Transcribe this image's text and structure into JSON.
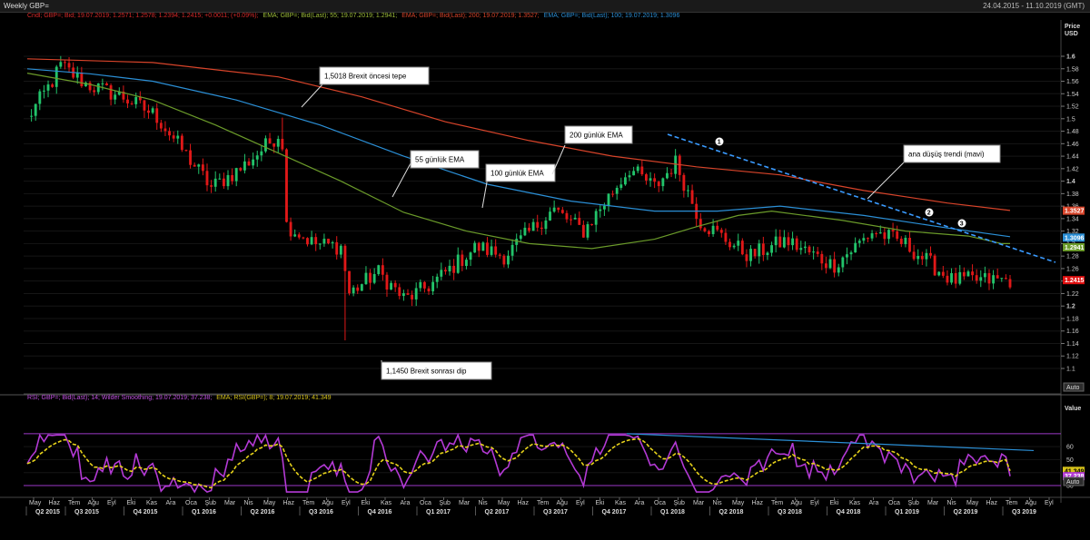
{
  "header": {
    "title": "Weekly GBP=",
    "date_range": "24.04.2015 - 11.10.2019 (GMT)"
  },
  "legend_main": {
    "candles": "Cndl; GBP=; Bid; 19.07.2019; 1.2571; 1.2578; 1.2394; 1.2415; +0.0011; (+0.09%);",
    "ema55": "EMA; GBP=; Bid(Last); 55; 19.07.2019; 1.2941;",
    "ema200": "EMA; GBP=; Bid(Last); 200; 19.07.2019; 1.3527;",
    "ema100": "EMA; GBP=; Bid(Last); 100; 19.07.2019; 1.3096"
  },
  "legend_rsi": {
    "rsi": "RSI; GBP=; Bid(Last); 14; Wilder Smoothing; 19.07.2019; 37.238;",
    "ema": "EMA; RSI(GBP=); 8; 19.07.2019; 41.349"
  },
  "axis_main": {
    "unit_line1": "Price",
    "unit_line2": "USD",
    "ticks": [
      "1.6",
      "1.58",
      "1.56",
      "1.54",
      "1.52",
      "1.5",
      "1.48",
      "1.46",
      "1.44",
      "1.42",
      "1.4",
      "1.38",
      "1.36",
      "1.34",
      "1.32",
      "1.3",
      "1.28",
      "1.26",
      "1.24",
      "1.22",
      "1.2",
      "1.18",
      "1.16",
      "1.14",
      "1.12",
      "1.1"
    ],
    "auto": "Auto"
  },
  "axis_rsi": {
    "unit": "Value",
    "ticks": [
      "60",
      "50",
      "40",
      "30"
    ],
    "auto": "Auto"
  },
  "price_tags": [
    {
      "label": "1.3527",
      "value": 1.3527,
      "color": "#d8442a"
    },
    {
      "label": "1.3096",
      "value": 1.3096,
      "color": "#2b8fd6"
    },
    {
      "label": "1.2941",
      "value": 1.2941,
      "color": "#6b9b2a"
    },
    {
      "label": "1.2415",
      "value": 1.2415,
      "color": "#e01010"
    }
  ],
  "rsi_tags": [
    {
      "label": "41.349",
      "value": 41.349,
      "color": "#d6c21a",
      "text": "#000"
    },
    {
      "label": "37.238",
      "value": 37.238,
      "color": "#b43ad6",
      "text": "#fff"
    }
  ],
  "x_months": [
    "May",
    "Haz",
    "Tem",
    "Ağu",
    "Eyl",
    "Eki",
    "Kas",
    "Ara",
    "Oca",
    "Şub",
    "Mar",
    "Nis",
    "May",
    "Haz",
    "Tem",
    "Ağu",
    "Eyl",
    "Eki",
    "Kas",
    "Ara",
    "Oca",
    "Şub",
    "Mar",
    "Nis",
    "May",
    "Haz",
    "Tem",
    "Ağu",
    "Eyl",
    "Eki",
    "Kas",
    "Ara",
    "Oca",
    "Şub",
    "Mar",
    "Nis",
    "May",
    "Haz",
    "Tem",
    "Ağu",
    "Eyl",
    "Eki",
    "Kas",
    "Ara",
    "Oca",
    "Şub",
    "Mar",
    "Nis",
    "May",
    "Haz",
    "Tem",
    "Ağu",
    "Eyl"
  ],
  "x_quarters": [
    {
      "label": "Q2 2015",
      "month": 0
    },
    {
      "label": "Q3 2015",
      "month": 2
    },
    {
      "label": "Q4 2015",
      "month": 5
    },
    {
      "label": "Q1 2016",
      "month": 8
    },
    {
      "label": "Q2 2016",
      "month": 11
    },
    {
      "label": "Q3 2016",
      "month": 14
    },
    {
      "label": "Q4 2016",
      "month": 17
    },
    {
      "label": "Q1 2017",
      "month": 20
    },
    {
      "label": "Q2 2017",
      "month": 23
    },
    {
      "label": "Q3 2017",
      "month": 26
    },
    {
      "label": "Q4 2017",
      "month": 29
    },
    {
      "label": "Q1 2018",
      "month": 32
    },
    {
      "label": "Q2 2018",
      "month": 35
    },
    {
      "label": "Q3 2018",
      "month": 38
    },
    {
      "label": "Q4 2018",
      "month": 41
    },
    {
      "label": "Q1 2019",
      "month": 44
    },
    {
      "label": "Q2 2019",
      "month": 47
    },
    {
      "label": "Q3 2019",
      "month": 50
    }
  ],
  "annotations": {
    "brexit_top": "1,5018 Brexit öncesi tepe",
    "brexit_dip": "1,1450 Brexit sonrası dip",
    "ema55": "55 günlük EMA",
    "ema100": "100 günlük EMA",
    "ema200": "200 günlük EMA",
    "trend": "ana düşüş trendi (mavi)",
    "n1": "1",
    "n2": "2",
    "n3": "3"
  },
  "chart_data": {
    "type": "line",
    "title": "Weekly GBP=",
    "ylabel": "Price USD",
    "ylim": [
      1.09,
      1.615
    ],
    "x_range": [
      "2015-04-24",
      "2019-10-11"
    ],
    "close_anchors": [
      {
        "x": "2015-04-24",
        "y": 1.5
      },
      {
        "x": "2015-06-05",
        "y": 1.56
      },
      {
        "x": "2015-06-19",
        "y": 1.585
      },
      {
        "x": "2015-08-01",
        "y": 1.555
      },
      {
        "x": "2015-10-01",
        "y": 1.535
      },
      {
        "x": "2015-11-25",
        "y": 1.505
      },
      {
        "x": "2016-01-25",
        "y": 1.43
      },
      {
        "x": "2016-02-26",
        "y": 1.39
      },
      {
        "x": "2016-04-15",
        "y": 1.42
      },
      {
        "x": "2016-05-20",
        "y": 1.45
      },
      {
        "x": "2016-06-23",
        "y": 1.48
      },
      {
        "x": "2016-07-01",
        "y": 1.33
      },
      {
        "x": "2016-08-15",
        "y": 1.3
      },
      {
        "x": "2016-09-30",
        "y": 1.295
      },
      {
        "x": "2016-10-14",
        "y": 1.22
      },
      {
        "x": "2016-12-01",
        "y": 1.255
      },
      {
        "x": "2017-01-15",
        "y": 1.21
      },
      {
        "x": "2017-03-01",
        "y": 1.235
      },
      {
        "x": "2017-05-15",
        "y": 1.295
      },
      {
        "x": "2017-07-01",
        "y": 1.28
      },
      {
        "x": "2017-09-20",
        "y": 1.355
      },
      {
        "x": "2017-11-10",
        "y": 1.32
      },
      {
        "x": "2018-01-26",
        "y": 1.42
      },
      {
        "x": "2018-03-10",
        "y": 1.39
      },
      {
        "x": "2018-04-13",
        "y": 1.43
      },
      {
        "x": "2018-05-25",
        "y": 1.335
      },
      {
        "x": "2018-08-15",
        "y": 1.28
      },
      {
        "x": "2018-10-15",
        "y": 1.305
      },
      {
        "x": "2019-01-02",
        "y": 1.265
      },
      {
        "x": "2019-03-10",
        "y": 1.32
      },
      {
        "x": "2019-05-01",
        "y": 1.3
      },
      {
        "x": "2019-07-19",
        "y": 1.2415
      }
    ],
    "notable_points": {
      "pre_brexit_top": 1.5018,
      "post_brexit_dip": 1.145
    },
    "series": [
      {
        "name": "EMA 55",
        "color": "#6b9b2a",
        "last": 1.2941,
        "points": [
          [
            0,
            1.573
          ],
          [
            15,
            1.555
          ],
          [
            30,
            1.53
          ],
          [
            45,
            1.49
          ],
          [
            60,
            1.445
          ],
          [
            75,
            1.4
          ],
          [
            90,
            1.35
          ],
          [
            105,
            1.32
          ],
          [
            120,
            1.3
          ],
          [
            135,
            1.292
          ],
          [
            150,
            1.307
          ],
          [
            160,
            1.327
          ],
          [
            170,
            1.345
          ],
          [
            178,
            1.352
          ],
          [
            195,
            1.337
          ],
          [
            210,
            1.32
          ],
          [
            225,
            1.312
          ],
          [
            235,
            1.3
          ],
          [
            233,
            1.3
          ]
        ]
      },
      {
        "name": "EMA 100",
        "color": "#2b8fd6",
        "last": 1.3096,
        "points": [
          [
            0,
            1.58
          ],
          [
            15,
            1.572
          ],
          [
            30,
            1.56
          ],
          [
            50,
            1.53
          ],
          [
            70,
            1.49
          ],
          [
            90,
            1.44
          ],
          [
            110,
            1.395
          ],
          [
            130,
            1.368
          ],
          [
            150,
            1.352
          ],
          [
            165,
            1.352
          ],
          [
            180,
            1.36
          ],
          [
            200,
            1.345
          ],
          [
            220,
            1.325
          ],
          [
            235,
            1.311
          ]
        ]
      },
      {
        "name": "EMA 200",
        "color": "#d8442a",
        "last": 1.3527,
        "points": [
          [
            0,
            1.596
          ],
          [
            30,
            1.59
          ],
          [
            60,
            1.567
          ],
          [
            80,
            1.535
          ],
          [
            100,
            1.495
          ],
          [
            120,
            1.465
          ],
          [
            140,
            1.44
          ],
          [
            160,
            1.423
          ],
          [
            180,
            1.41
          ],
          [
            200,
            1.385
          ],
          [
            220,
            1.365
          ],
          [
            235,
            1.353
          ]
        ]
      }
    ],
    "rsi": {
      "name": "RSI 14",
      "ylim": [
        23,
        72
      ],
      "levels": [
        70,
        30
      ],
      "last": 37.238,
      "ema8_last": 41.349
    }
  }
}
